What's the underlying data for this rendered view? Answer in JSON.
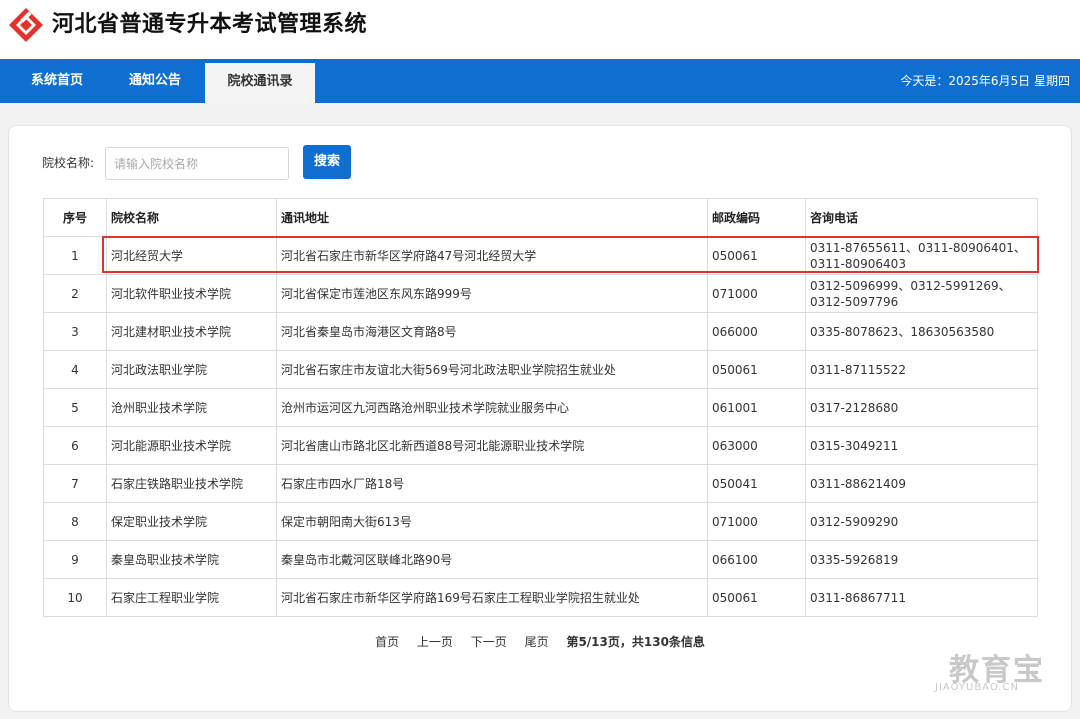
{
  "header": {
    "site_title": "河北省普通专升本考试管理系统"
  },
  "nav": {
    "items": [
      {
        "label": "系统首页",
        "active": false
      },
      {
        "label": "通知公告",
        "active": false
      },
      {
        "label": "院校通讯录",
        "active": true
      }
    ],
    "date_text": "今天是：2025年6月5日 星期四"
  },
  "search": {
    "label": "院校名称:",
    "placeholder": "请输入院校名称",
    "value": "",
    "button_label": "搜索"
  },
  "table": {
    "headers": [
      "序号",
      "院校名称",
      "通讯地址",
      "邮政编码",
      "咨询电话"
    ],
    "rows": [
      {
        "no": "1",
        "name": "河北经贸大学",
        "address": "河北省石家庄市新华区学府路47号河北经贸大学",
        "postcode": "050061",
        "phone_line1": "0311-87655611、0311-80906401、",
        "phone_line2": "0311-80906403",
        "highlighted": true
      },
      {
        "no": "2",
        "name": "河北软件职业技术学院",
        "address": "河北省保定市莲池区东风东路999号",
        "postcode": "071000",
        "phone_line1": "0312-5096999、0312-5991269、",
        "phone_line2": "0312-5097796",
        "highlighted": false
      },
      {
        "no": "3",
        "name": "河北建材职业技术学院",
        "address": "河北省秦皇岛市海港区文育路8号",
        "postcode": "066000",
        "phone_line1": "0335-8078623、18630563580",
        "phone_line2": "",
        "highlighted": false
      },
      {
        "no": "4",
        "name": "河北政法职业学院",
        "address": "河北省石家庄市友谊北大街569号河北政法职业学院招生就业处",
        "postcode": "050061",
        "phone_line1": "0311-87115522",
        "phone_line2": "",
        "highlighted": false
      },
      {
        "no": "5",
        "name": "沧州职业技术学院",
        "address": "沧州市运河区九河西路沧州职业技术学院就业服务中心",
        "postcode": "061001",
        "phone_line1": "0317-2128680",
        "phone_line2": "",
        "highlighted": false
      },
      {
        "no": "6",
        "name": "河北能源职业技术学院",
        "address": "河北省唐山市路北区北新西道88号河北能源职业技术学院",
        "postcode": "063000",
        "phone_line1": "0315-3049211",
        "phone_line2": "",
        "highlighted": false
      },
      {
        "no": "7",
        "name": "石家庄铁路职业技术学院",
        "address": "石家庄市四水厂路18号",
        "postcode": "050041",
        "phone_line1": "0311-88621409",
        "phone_line2": "",
        "highlighted": false
      },
      {
        "no": "8",
        "name": "保定职业技术学院",
        "address": "保定市朝阳南大街613号",
        "postcode": "071000",
        "phone_line1": "0312-5909290",
        "phone_line2": "",
        "highlighted": false
      },
      {
        "no": "9",
        "name": "秦皇岛职业技术学院",
        "address": "秦皇岛市北戴河区联峰北路90号",
        "postcode": "066100",
        "phone_line1": "0335-5926819",
        "phone_line2": "",
        "highlighted": false
      },
      {
        "no": "10",
        "name": "石家庄工程职业学院",
        "address": "河北省石家庄市新华区学府路169号石家庄工程职业学院招生就业处",
        "postcode": "050061",
        "phone_line1": "0311-86867711",
        "phone_line2": "",
        "highlighted": false
      }
    ]
  },
  "pager": {
    "first": "首页",
    "prev": "上一页",
    "next": "下一页",
    "last": "尾页",
    "info": "第5/13页，共130条信息"
  },
  "watermark": {
    "text": "教育宝",
    "sub": "JIAOYUBAO.CN"
  },
  "colors": {
    "nav_blue": "#0f6fd0",
    "logo_red": "#e2322b",
    "highlight_border": "#e2322b"
  },
  "icons": {
    "logo": "diamond-logo-icon"
  }
}
